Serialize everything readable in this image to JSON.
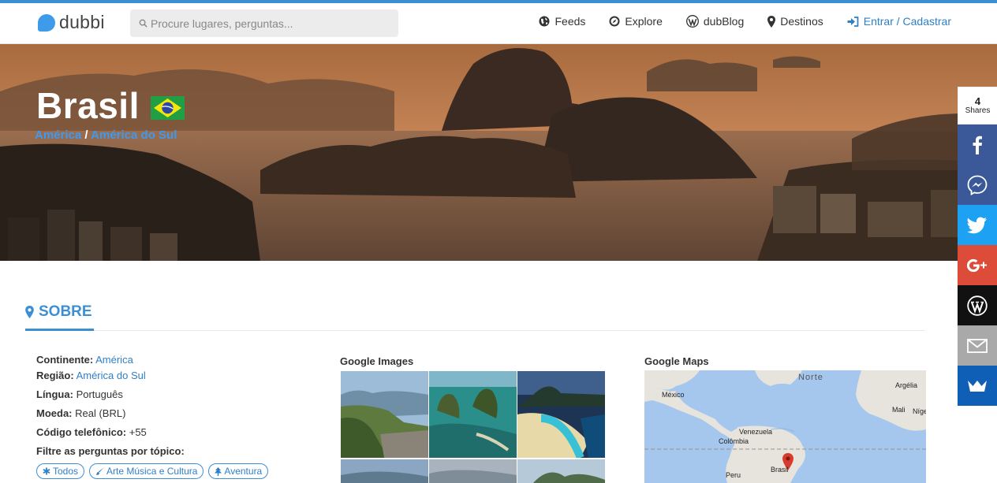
{
  "header": {
    "logo_text": "dubbi",
    "search_placeholder": "Procure lugares, perguntas...",
    "nav": [
      {
        "label": "Feeds",
        "icon": "globe-icon"
      },
      {
        "label": "Explore",
        "icon": "compass-icon"
      },
      {
        "label": "dubBlog",
        "icon": "wordpress-icon"
      },
      {
        "label": "Destinos",
        "icon": "map-pin-icon"
      },
      {
        "label": "Entrar / Cadastrar",
        "icon": "sign-in-icon"
      }
    ]
  },
  "hero": {
    "title": "Brasil",
    "flag_icon": "brazil-flag-icon",
    "breadcrumb": [
      "América",
      "América do Sul"
    ],
    "breadcrumb_separator": "/"
  },
  "share": {
    "count": "4",
    "count_label": "Shares",
    "buttons": [
      {
        "name": "facebook",
        "color": "#3b5998"
      },
      {
        "name": "messenger",
        "color": "#3b5998"
      },
      {
        "name": "twitter",
        "color": "#1da1f2"
      },
      {
        "name": "google-plus",
        "color": "#dd4b39"
      },
      {
        "name": "wordpress",
        "color": "#111111"
      },
      {
        "name": "email",
        "color": "#a9a9a9"
      },
      {
        "name": "sumo",
        "color": "#0e5fb5"
      }
    ]
  },
  "sobre": {
    "heading": "SOBRE",
    "facts": {
      "continente_label": "Continente:",
      "continente_value": "América",
      "regiao_label": "Região:",
      "regiao_value": "América do Sul",
      "lingua_label": "Língua:",
      "lingua_value": "Português",
      "moeda_label": "Moeda:",
      "moeda_value": "Real (BRL)",
      "codigo_label": "Código telefônico:",
      "codigo_value": "+55",
      "filtre_label": "Filtre as perguntas por tópico:"
    },
    "tags": [
      "Todos",
      "Arte Música e Cultura",
      "Aventura"
    ],
    "google_images_title": "Google Images",
    "google_maps_title": "Google Maps",
    "map_labels": [
      "Norte",
      "México",
      "Argélia",
      "Mali",
      "Níger",
      "Venezuela",
      "Colômbia",
      "Peru",
      "Brasil"
    ]
  },
  "colors": {
    "accent": "#3d8fd4",
    "link": "#2f7fc5"
  }
}
